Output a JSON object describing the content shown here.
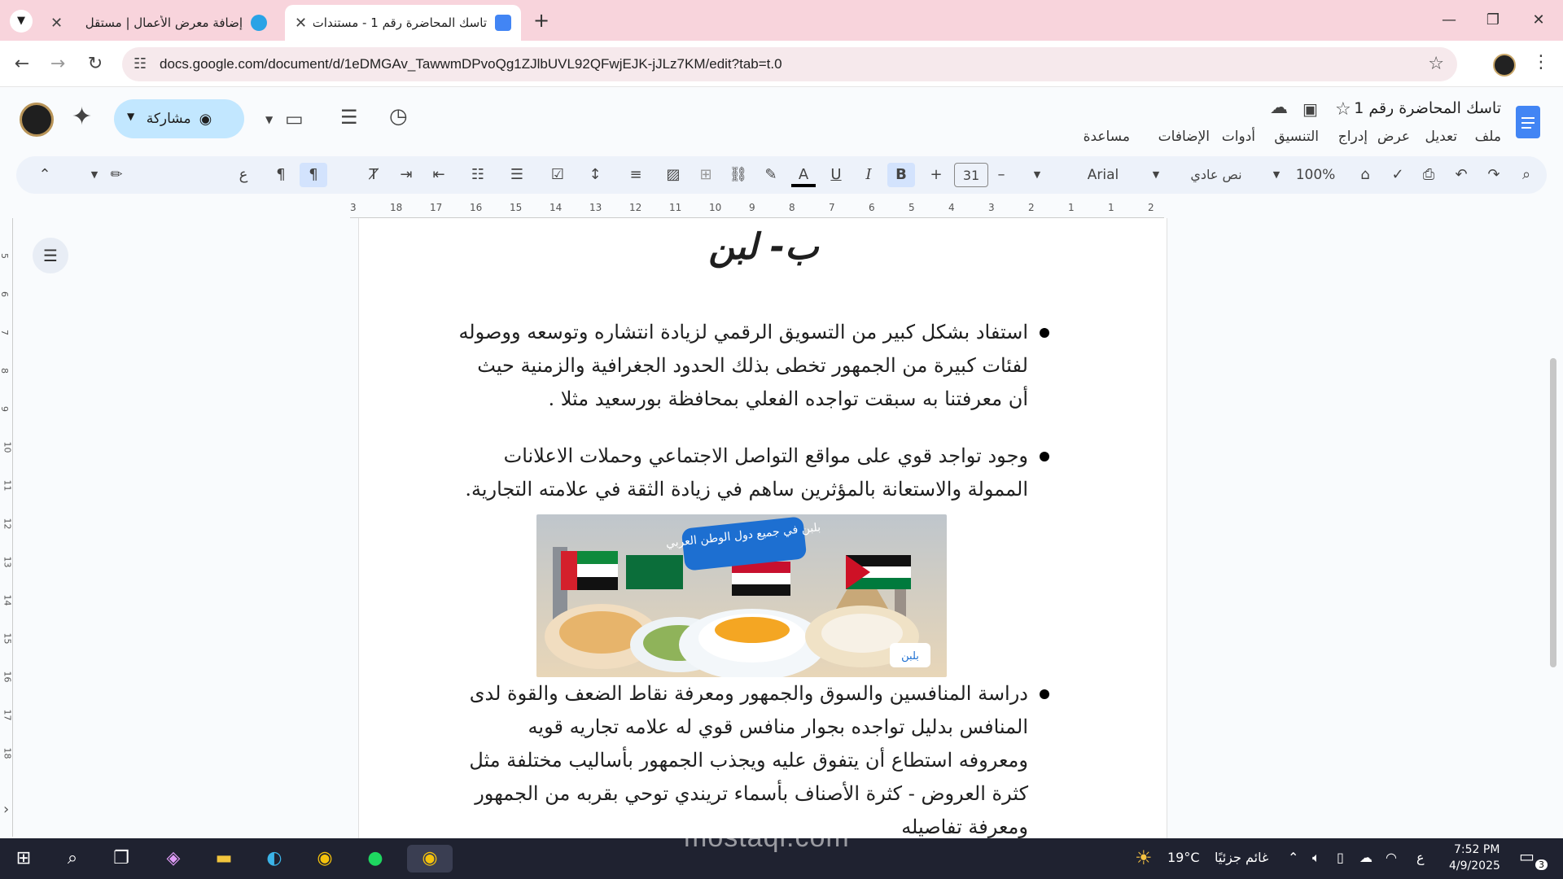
{
  "browser": {
    "tabs": [
      {
        "title": "إضافة معرض الأعمال | مستقل",
        "active": false
      },
      {
        "title": "تاسك المحاضرة رقم 1 - مستندات",
        "active": true
      }
    ],
    "url": "docs.google.com/document/d/1eDMGAv_TawwmDPvoQg1ZJlbUVL92QFwjEJK-jJLz7KM/edit?tab=t.0",
    "new_tab": "+",
    "close": "✕"
  },
  "docs": {
    "title": "تاسك المحاضرة رقم 1",
    "menus": [
      "ملف",
      "تعديل",
      "عرض",
      "إدراج",
      "التنسيق",
      "أدوات",
      "الإضافات",
      "مساعدة"
    ],
    "share_label": "مشاركة"
  },
  "toolbar": {
    "zoom": "100%",
    "style": "نص عادي",
    "font": "Arial",
    "font_size": "31",
    "bold": "B",
    "italic": "I",
    "underline": "U",
    "text_color": "A",
    "minus": "–",
    "plus": "+"
  },
  "ruler": {
    "numbers": [
      "2",
      "1",
      "1",
      "2",
      "3",
      "4",
      "5",
      "6",
      "7",
      "8",
      "9",
      "10",
      "11",
      "12",
      "13",
      "14",
      "15",
      "16",
      "17",
      "18",
      "3"
    ]
  },
  "vruler": {
    "numbers": [
      "5",
      "6",
      "7",
      "8",
      "9",
      "10",
      "11",
      "12",
      "13",
      "14",
      "15",
      "16",
      "17",
      "18"
    ]
  },
  "document": {
    "heading": "ب- لبن",
    "paragraphs": [
      "استفاد بشكل كبير من التسويق الرقمي لزيادة انتشاره وتوسعه ووصوله لفئات كبيرة من الجمهور تخطى بذلك الحدود الجغرافية والزمنية  حيث أن معرفتنا به سبقت تواجده الفعلي بمحافظة بورسعيد مثلا .",
      "وجود تواجد قوي على مواقع التواصل الاجتماعي وحملات الاعلانات الممولة والاستعانة بالمؤثرين ساهم في زيادة الثقة في علامته التجارية.",
      "دراسة المنافسين والسوق والجمهور ومعرفة نقاط الضعف والقوة لدى المنافس بدليل تواجده بجوار منافس قوي له علامه تجاريه قويه ومعروفه استطاع أن يتفوق عليه ويجذب الجمهور بأساليب مختلفة مثل كثرة العروض - كثرة الأصناف بأسماء تريندي توحي بقربه من الجمهور ومعرفة تفاصيله"
    ],
    "image_banner": "بلبن في جميع دول الوطن العربي",
    "image_logo": "بلبن"
  },
  "taskbar": {
    "weather_temp": "19°C",
    "weather_desc": "غائم جزئيًا",
    "time": "7:52 PM",
    "date": "4/9/2025",
    "lang": "ع",
    "notif_count": "3",
    "watermark": "mostaql.com"
  },
  "colors": {
    "tabstrip": "#f8d4dc",
    "share": "#c2e7ff",
    "toolbar": "#edf2fa",
    "taskbar": "#1f2230"
  }
}
